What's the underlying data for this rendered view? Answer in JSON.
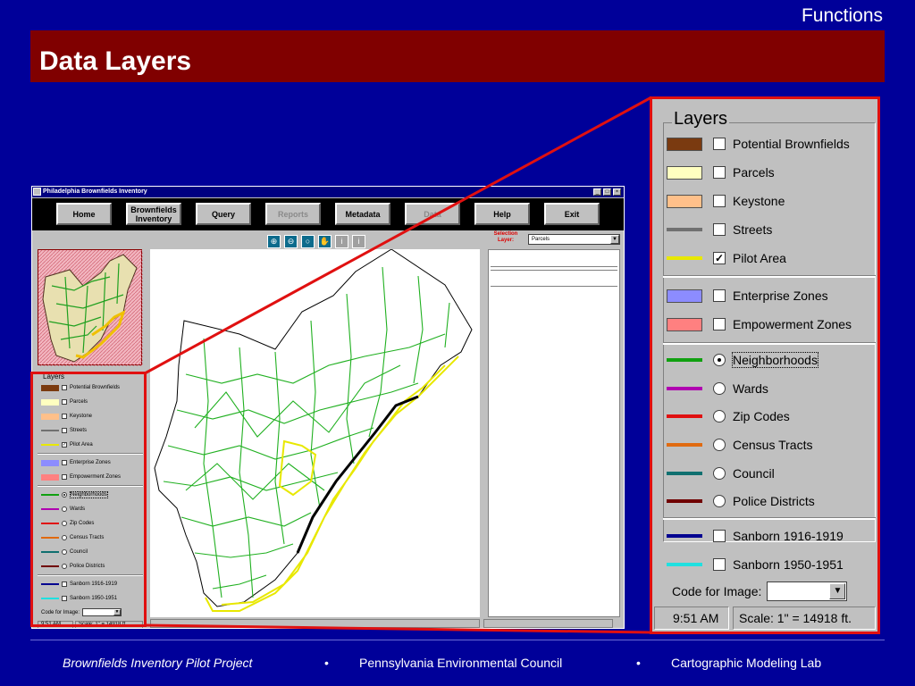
{
  "header": {
    "section": "Functions",
    "title": "Data Layers"
  },
  "app": {
    "window_title": "Philadelphia Brownfields Inventory",
    "window_controls": [
      "_",
      "□",
      "×"
    ],
    "toolbar": [
      {
        "label": "Home",
        "enabled": true
      },
      {
        "label": "Brownfields Inventory",
        "enabled": true
      },
      {
        "label": "Query",
        "enabled": true
      },
      {
        "label": "Reports",
        "enabled": false
      },
      {
        "label": "Metadata",
        "enabled": true
      },
      {
        "label": "Data",
        "enabled": false
      },
      {
        "label": "Help",
        "enabled": true
      },
      {
        "label": "Exit",
        "enabled": true
      }
    ],
    "map_tools": [
      "zoom-in-icon",
      "zoom-out-icon",
      "zoom-full-icon",
      "pan-hand-icon",
      "info-icon",
      "identify-icon"
    ],
    "selection_layer_label": "Selection Layer:",
    "selection_layer_value": "Parcels",
    "status": {
      "time": "9:51 AM",
      "scale": "Scale: 1\" = 14918 ft."
    }
  },
  "layers": {
    "heading": "Layers",
    "groups": [
      [
        {
          "label": "Potential Brownfields",
          "swatch": "#7a3a10",
          "kind": "box",
          "control": "checkbox",
          "checked": false
        },
        {
          "label": "Parcels",
          "swatch": "#ffffc0",
          "kind": "box",
          "control": "checkbox",
          "checked": false
        },
        {
          "label": "Keystone",
          "swatch": "#ffc08a",
          "kind": "box",
          "control": "checkbox",
          "checked": false
        },
        {
          "label": "Streets",
          "swatch": "#707070",
          "kind": "line",
          "control": "checkbox",
          "checked": false
        },
        {
          "label": "Pilot Area",
          "swatch": "#e8e800",
          "kind": "line",
          "control": "checkbox",
          "checked": true
        }
      ],
      [
        {
          "label": "Enterprise Zones",
          "swatch": "#8c8cff",
          "kind": "box",
          "control": "checkbox",
          "checked": false
        },
        {
          "label": "Empowerment Zones",
          "swatch": "#ff8080",
          "kind": "box",
          "control": "checkbox",
          "checked": false
        }
      ],
      [
        {
          "label": "Neighborhoods",
          "swatch": "#10a010",
          "kind": "line",
          "control": "radio",
          "checked": true
        },
        {
          "label": "Wards",
          "swatch": "#b000b0",
          "kind": "line",
          "control": "radio",
          "checked": false
        },
        {
          "label": "Zip Codes",
          "swatch": "#e01010",
          "kind": "line",
          "control": "radio",
          "checked": false
        },
        {
          "label": "Census Tracts",
          "swatch": "#e06a10",
          "kind": "line",
          "control": "radio",
          "checked": false
        },
        {
          "label": "Council",
          "swatch": "#107070",
          "kind": "line",
          "control": "radio",
          "checked": false
        },
        {
          "label": "Police Districts",
          "swatch": "#700000",
          "kind": "line",
          "control": "radio",
          "checked": false
        }
      ],
      [
        {
          "label": "Sanborn 1916-1919",
          "swatch": "#000090",
          "kind": "line",
          "control": "checkbox",
          "checked": false
        },
        {
          "label": "Sanborn 1950-1951",
          "swatch": "#20e0e0",
          "kind": "line",
          "control": "checkbox",
          "checked": false
        }
      ]
    ],
    "code_for_image_label": "Code for Image:",
    "code_for_image_value": ""
  },
  "footer": {
    "project": "Brownfields Inventory Pilot Project",
    "bullet": "•",
    "council": "Pennsylvania Environmental Council",
    "lab": "Cartographic Modeling Lab"
  }
}
